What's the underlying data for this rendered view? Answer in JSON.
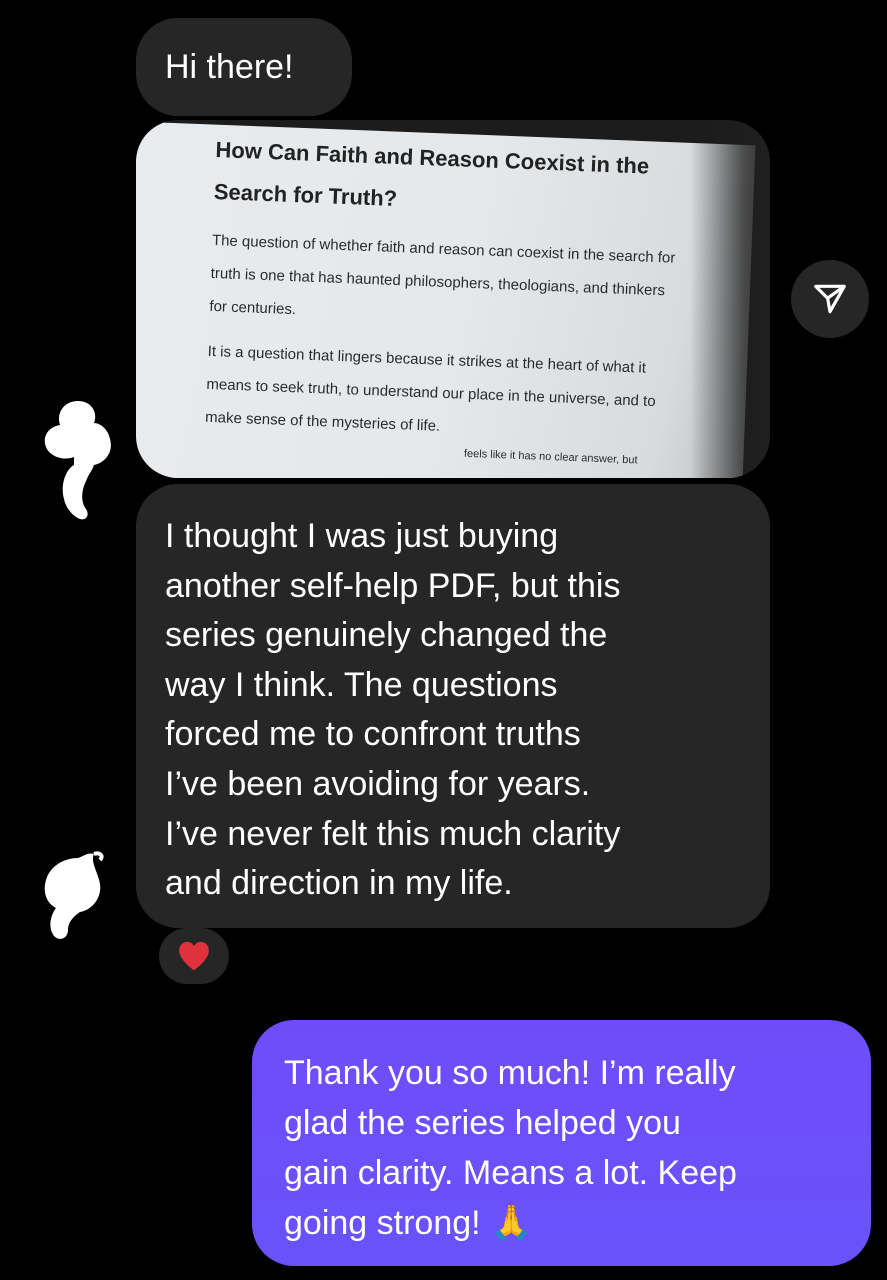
{
  "messages": {
    "greeting": "Hi there!",
    "attachment": {
      "icon": "photo-attachment",
      "title_lines": [
        "How Can Faith and Reason Coexist in the",
        "Search for Truth?"
      ],
      "paragraph1": [
        "The question of whether faith and reason can coexist in the search for",
        "truth is one that has haunted philosophers, theologians, and thinkers",
        "for centuries."
      ],
      "paragraph2": [
        "It is a question that lingers because it strikes at the heart of what it",
        "means to seek truth, to understand our place in the universe, and to",
        "make sense of the mysteries of life.",
        "feels like it has no clear answer, but"
      ]
    },
    "review_lines": [
      "I thought I was just buying",
      "another self-help PDF, but this",
      "series genuinely changed the",
      "way I think. The questions",
      "forced me to confront truths",
      "I’ve been avoiding for years.",
      "I’ve never felt this much clarity",
      "and direction in my life."
    ],
    "reaction": {
      "icon": "heart-icon",
      "color": "#e0323a"
    },
    "reply_lines": [
      "Thank you so much! I’m really",
      "glad the series helped you",
      "gain clarity. Means a lot. Keep",
      "going strong!"
    ],
    "reply_emoji": "🙏"
  },
  "share_button": {
    "icon": "share-send-icon"
  },
  "colors": {
    "incoming_bubble": "#262626",
    "outgoing_bubble": "#6a52fb",
    "background": "#000000"
  }
}
